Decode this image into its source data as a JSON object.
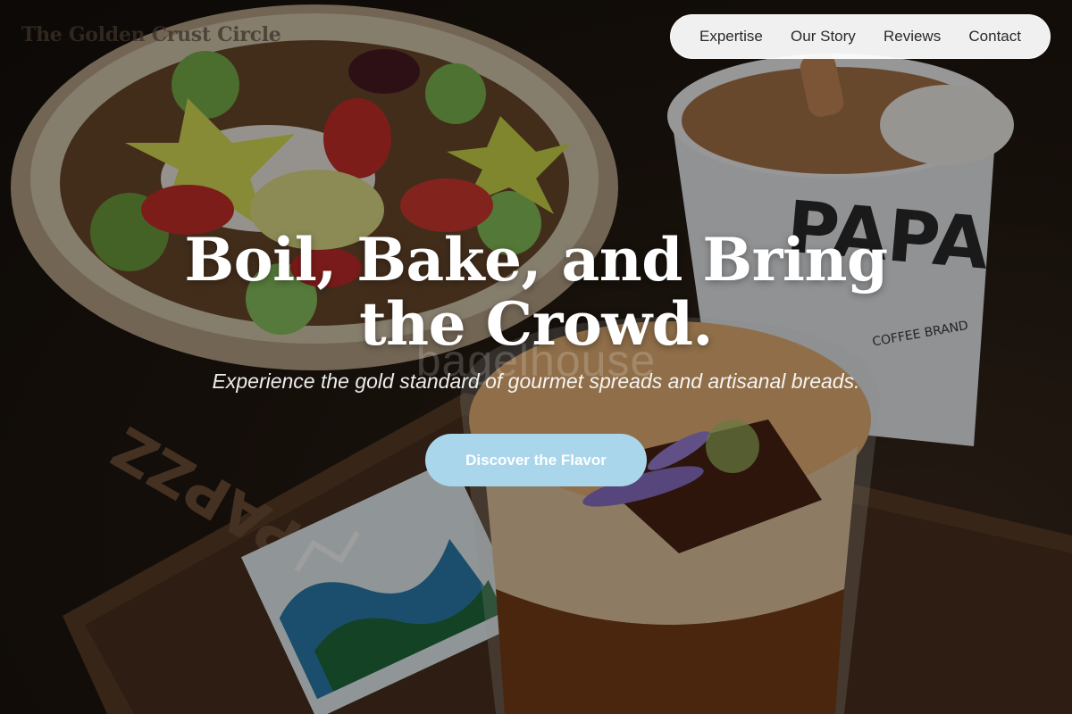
{
  "header": {
    "brand": "The Golden Crust Circle",
    "nav": [
      {
        "label": "Expertise"
      },
      {
        "label": "Our Story"
      },
      {
        "label": "Reviews"
      },
      {
        "label": "Contact"
      }
    ]
  },
  "hero": {
    "title": "Boil, Bake, and Bring the Crowd.",
    "watermark": "bagelhouse",
    "subtitle": "Experience the gold standard of gourmet spreads and artisanal breads.",
    "cta_label": "Discover the Flavor"
  },
  "photo": {
    "cup_brand": "PAPA",
    "cup_small_text": "COFFEE BRAND",
    "tray_text": "PAPZZ"
  },
  "colors": {
    "cta": "#a9d6ea",
    "nav_bg": "#ffffff",
    "title": "#ffffff"
  }
}
